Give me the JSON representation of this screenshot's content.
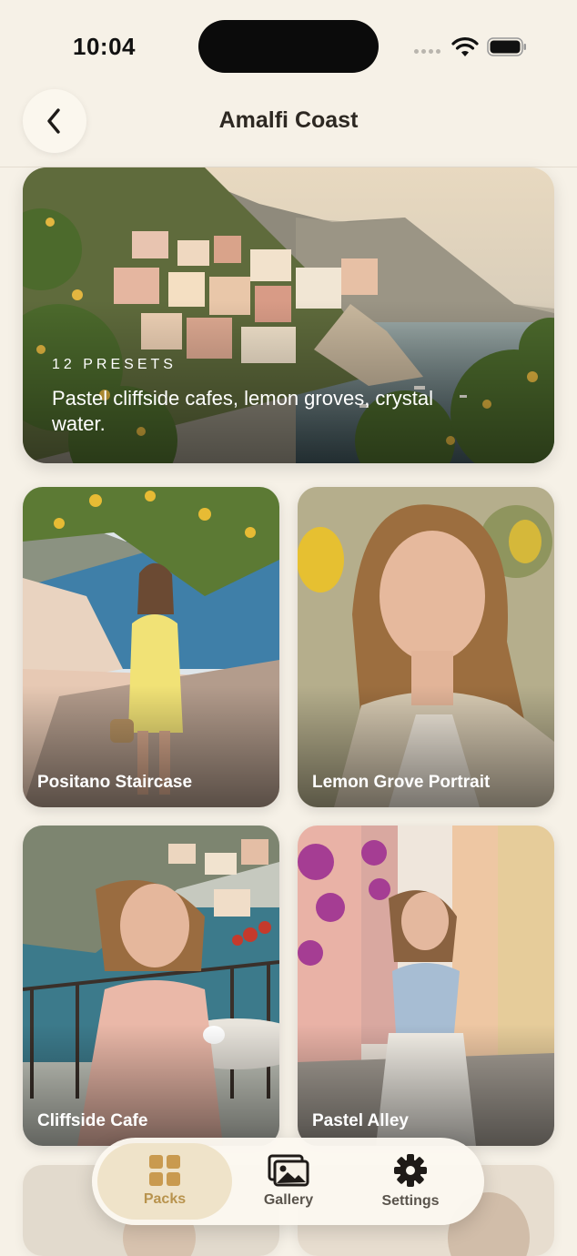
{
  "status_bar": {
    "time": "10:04"
  },
  "header": {
    "title": "Amalfi Coast",
    "back_icon": "chevron-left-icon"
  },
  "hero": {
    "preset_count": "12 PRESETS",
    "description": "Pastel cliffside cafes, lemon groves, crystal water."
  },
  "presets": [
    {
      "label": "Positano Staircase"
    },
    {
      "label": "Lemon Grove Portrait"
    },
    {
      "label": "Cliffside Cafe"
    },
    {
      "label": "Pastel Alley"
    }
  ],
  "tab_bar": {
    "tabs": [
      {
        "label": "Packs",
        "icon": "grid-icon",
        "active": true
      },
      {
        "label": "Gallery",
        "icon": "photos-icon",
        "active": false
      },
      {
        "label": "Settings",
        "icon": "gear-icon",
        "active": false
      }
    ]
  },
  "colors": {
    "background": "#f6f1e7",
    "accent": "#b8934d",
    "active_tab": "#efe3c9"
  }
}
